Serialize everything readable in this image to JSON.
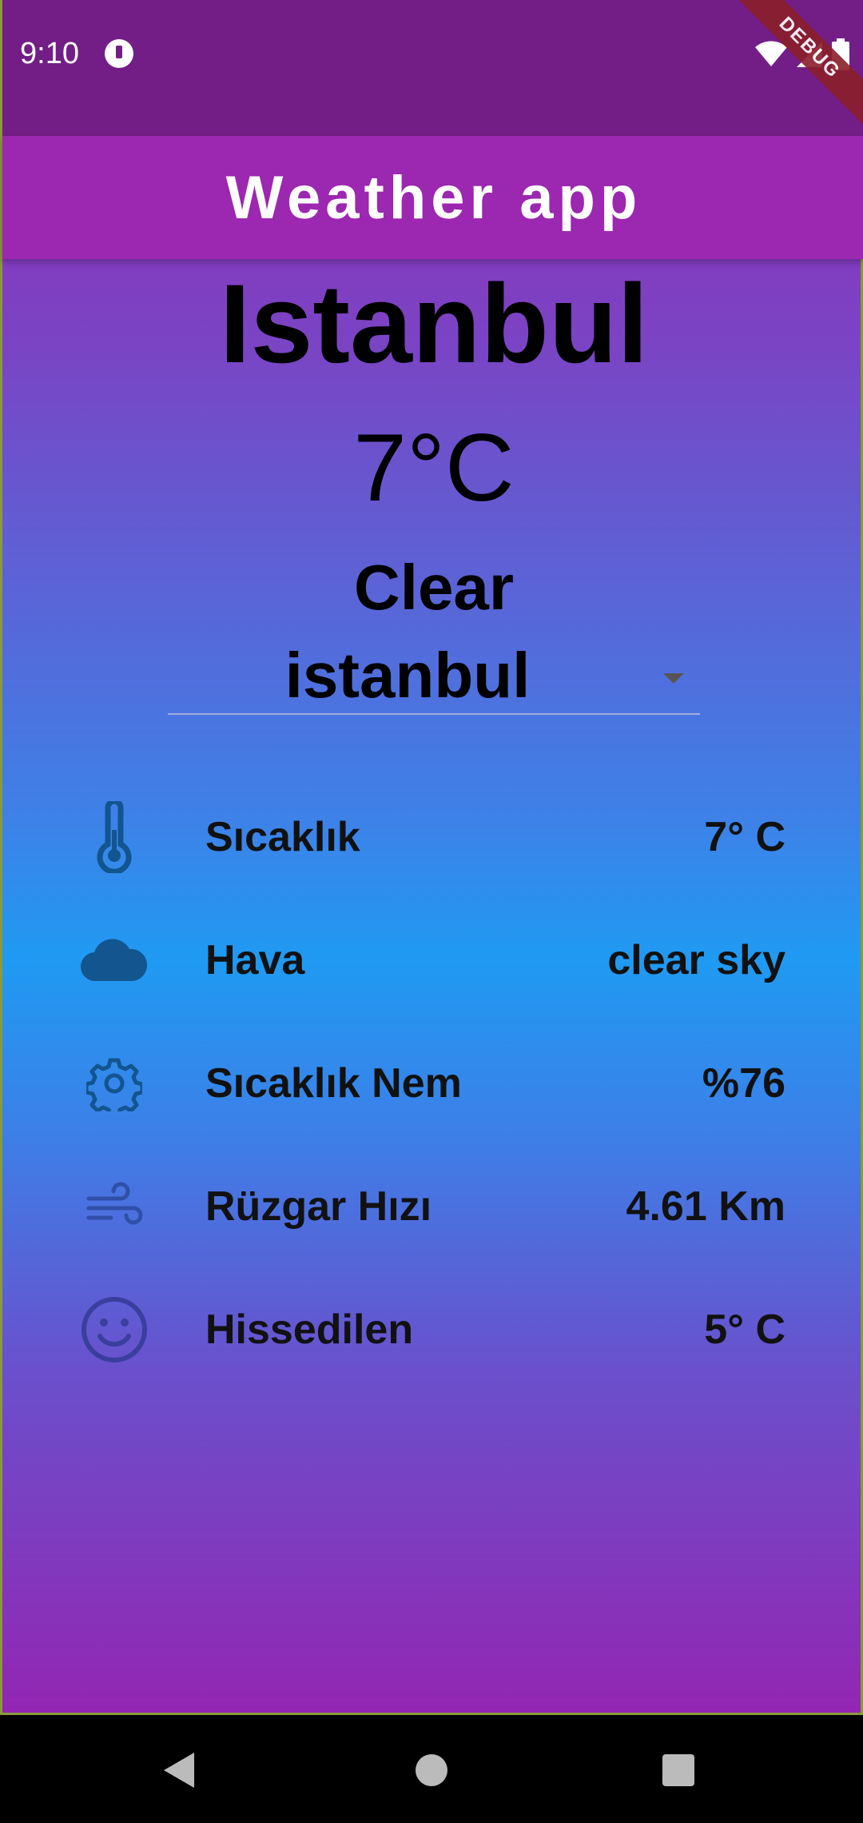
{
  "status_bar": {
    "time": "9:10",
    "debug_label": "DEBUG"
  },
  "app_bar": {
    "title": "Weather app"
  },
  "weather": {
    "city": "Istanbul",
    "temperature": "7°C",
    "condition": "Clear"
  },
  "city_select": {
    "selected": "istanbul"
  },
  "details": [
    {
      "icon": "thermometer-icon",
      "label": "Sıcaklık",
      "value": "7° C"
    },
    {
      "icon": "cloud-icon",
      "label": "Hava",
      "value": "clear sky"
    },
    {
      "icon": "gear-icon",
      "label": "Sıcaklık Nem",
      "value": "%76"
    },
    {
      "icon": "wind-icon",
      "label": "Rüzgar Hızı",
      "value": "4.61 Km"
    },
    {
      "icon": "smiley-icon",
      "label": "Hissedilen",
      "value": "5° C"
    }
  ],
  "colors": {
    "status_bar": "#731E86",
    "app_bar": "#9C27B0",
    "gradient_top": "#9B27B0",
    "gradient_middle": "#1F9AF2",
    "icon_dark_blue": "#12558F",
    "icon_indigo": "#3A3F9E"
  }
}
